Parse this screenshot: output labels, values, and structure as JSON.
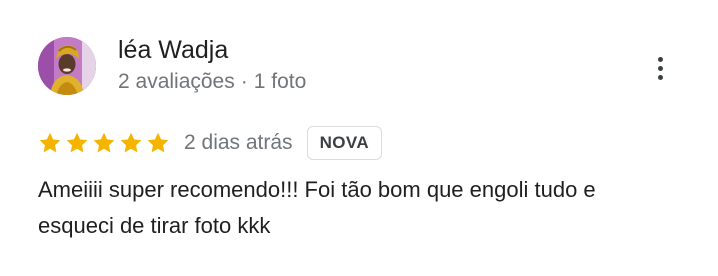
{
  "review": {
    "author_name": "léa Wadja",
    "reviews_count": "2 avaliações",
    "separator": "·",
    "photos_count": "1 foto",
    "rating": 5,
    "rating_max": 5,
    "date": "2 dias atrás",
    "badge": "NOVA",
    "text": "Ameiiii super recomendo!!! Foi tão bom que engoli tudo e esqueci de tirar foto kkk"
  },
  "icons": {
    "more": "more-vert-icon",
    "star": "star-icon"
  },
  "colors": {
    "star": "#f4b400",
    "meta_text": "#70757a",
    "text": "#1f1f1f",
    "badge_border": "#dadce0"
  }
}
